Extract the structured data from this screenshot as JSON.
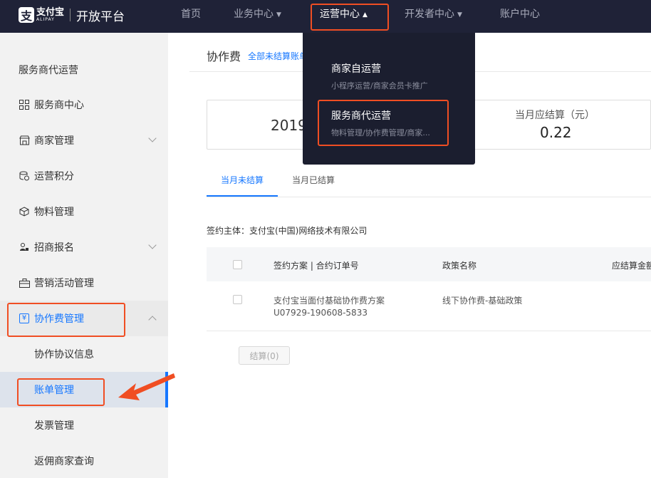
{
  "topbar": {
    "logo_mark": "支",
    "logo_text": "支付宝",
    "logo_sub": "ALIPAY",
    "platform": "开放平台",
    "nav": [
      {
        "label": "首页"
      },
      {
        "label": "业务中心"
      },
      {
        "label": "运营中心"
      },
      {
        "label": "开发者中心"
      },
      {
        "label": "账户中心"
      }
    ]
  },
  "dropdown": {
    "items": [
      {
        "title": "商家自运营",
        "subtitle": "小程序运营/商家会员卡推广"
      },
      {
        "title": "服务商代运营",
        "subtitle": "物料管理/协作费管理/商家..."
      }
    ]
  },
  "sidebar": {
    "section_title": "服务商代运营",
    "items": [
      {
        "label": "服务商中心",
        "icon": "grid-icon"
      },
      {
        "label": "商家管理",
        "icon": "store-icon"
      },
      {
        "label": "运营积分",
        "icon": "coins-icon"
      },
      {
        "label": "物料管理",
        "icon": "box-icon"
      },
      {
        "label": "招商报名",
        "icon": "signup-icon"
      },
      {
        "label": "营销活动管理",
        "icon": "toolbox-icon"
      },
      {
        "label": "协作费管理",
        "icon": "yen-icon"
      }
    ],
    "sub_items": [
      {
        "label": "协作协议信息"
      },
      {
        "label": "账单管理"
      },
      {
        "label": "发票管理"
      },
      {
        "label": "返佣商家查询"
      }
    ],
    "yen_glyph": "¥"
  },
  "content": {
    "title": "协作费",
    "link": "全部未结算账单",
    "stat_year": "2019",
    "stat_label": "当月应结算（元）",
    "stat_value": "0.22",
    "tabs": [
      {
        "label": "当月未结算"
      },
      {
        "label": "当月已结算"
      }
    ],
    "party": "签约主体：支付宝(中国)网络技术有限公司",
    "table": {
      "headers": [
        "签约方案 | 合约订单号",
        "政策名称",
        "应结算金额"
      ],
      "rows": [
        {
          "plan": "支付宝当面付基础协作费方案",
          "order": "U07929-190608-5833",
          "policy": "线下协作费-基础政策"
        }
      ]
    },
    "settle_button": "结算(0)"
  },
  "colors": {
    "topbar": "#1f2237",
    "accent": "#1677ff",
    "highlight": "#f04e23"
  }
}
